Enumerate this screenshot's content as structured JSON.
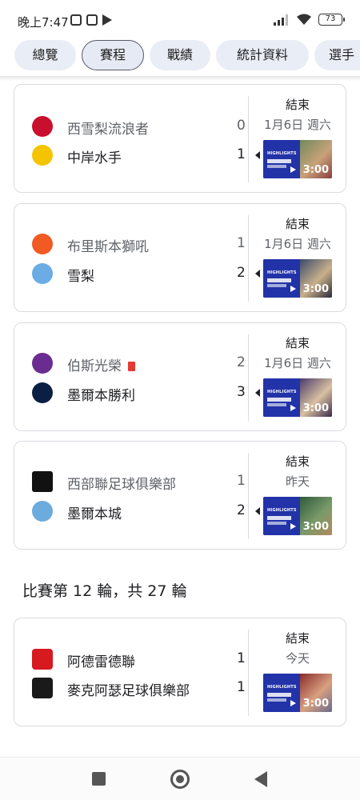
{
  "status_bar": {
    "time": "晚上7:47",
    "battery": "73"
  },
  "tabs": [
    {
      "label": "總覽",
      "active": false
    },
    {
      "label": "賽程",
      "active": true
    },
    {
      "label": "戰績",
      "active": false
    },
    {
      "label": "統計資料",
      "active": false
    },
    {
      "label": "選手",
      "active": false
    }
  ],
  "matches": [
    {
      "home": {
        "name": "西雪梨流浪者",
        "score": "0",
        "logo_color": "#c8102e",
        "winner": false,
        "red_card": false
      },
      "away": {
        "name": "中岸水手",
        "score": "1",
        "logo_color": "#f5c400",
        "winner": true,
        "red_card": false
      },
      "status": "結束",
      "date": "1月6日 週六",
      "video_duration": "3:00"
    },
    {
      "home": {
        "name": "布里斯本獅吼",
        "score": "1",
        "logo_color": "#f15a22",
        "winner": false,
        "red_card": false
      },
      "away": {
        "name": "雪梨",
        "score": "2",
        "logo_color": "#6cace4",
        "winner": true,
        "red_card": false
      },
      "status": "結束",
      "date": "1月6日 週六",
      "video_duration": "3:00"
    },
    {
      "home": {
        "name": "伯斯光榮",
        "score": "2",
        "logo_color": "#6a2c91",
        "winner": false,
        "red_card": true
      },
      "away": {
        "name": "墨爾本勝利",
        "score": "3",
        "logo_color": "#0a1f44",
        "winner": true,
        "red_card": false
      },
      "status": "結束",
      "date": "1月6日 週六",
      "video_duration": "3:00"
    },
    {
      "home": {
        "name": "西部聯足球俱樂部",
        "score": "1",
        "logo_color": "#111111",
        "winner": false,
        "red_card": false
      },
      "away": {
        "name": "墨爾本城",
        "score": "2",
        "logo_color": "#6cabdd",
        "winner": true,
        "red_card": false
      },
      "status": "結束",
      "date": "昨天",
      "video_duration": "3:00"
    }
  ],
  "round_heading": "比賽第 12 輪，共 27 輪",
  "round_matches": [
    {
      "home": {
        "name": "阿德雷德聯",
        "score": "1",
        "logo_color": "#d71920",
        "winner": false,
        "red_card": false
      },
      "away": {
        "name": "麥克阿瑟足球俱樂部",
        "score": "1",
        "logo_color": "#1a1a1a",
        "winner": false,
        "red_card": false
      },
      "status": "結束",
      "date": "今天",
      "video_duration": "3:00"
    }
  ],
  "video_thumb": {
    "brand_text": "HIGHLIGHTS",
    "league_text": "ISUZU UTE A-LEAGUE"
  }
}
